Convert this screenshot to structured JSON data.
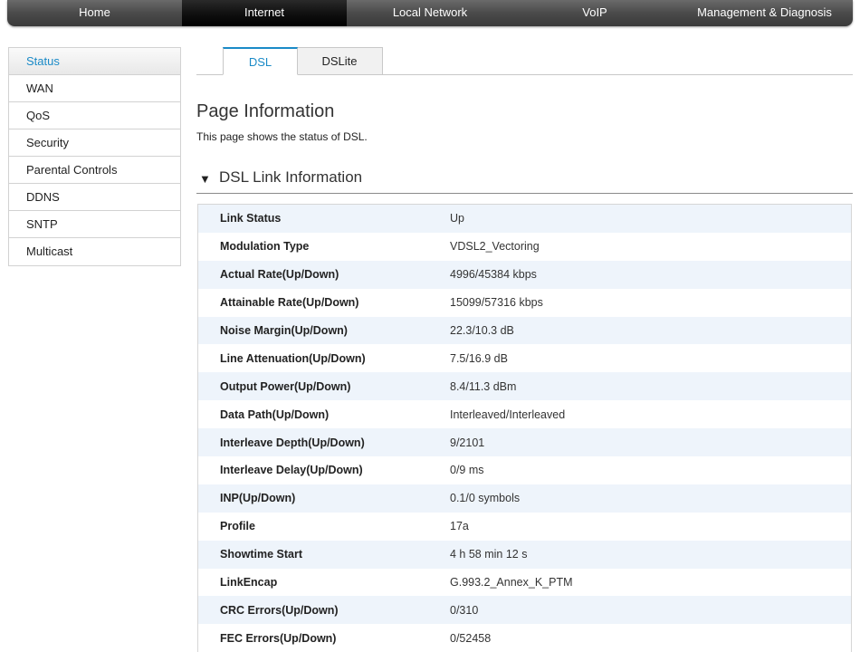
{
  "topnav": {
    "items": [
      {
        "label": "Home",
        "active": false
      },
      {
        "label": "Internet",
        "active": true
      },
      {
        "label": "Local Network",
        "active": false
      },
      {
        "label": "VoIP",
        "active": false
      },
      {
        "label": "Management & Diagnosis",
        "active": false
      }
    ]
  },
  "sidebar": {
    "items": [
      {
        "label": "Status",
        "active": true
      },
      {
        "label": "WAN"
      },
      {
        "label": "QoS"
      },
      {
        "label": "Security"
      },
      {
        "label": "Parental Controls"
      },
      {
        "label": "DDNS"
      },
      {
        "label": "SNTP"
      },
      {
        "label": "Multicast"
      }
    ]
  },
  "tabs": [
    {
      "label": "DSL",
      "active": true
    },
    {
      "label": "DSLite",
      "active": false
    }
  ],
  "page": {
    "title": "Page Information",
    "description": "This page shows the status of DSL."
  },
  "section": {
    "title": "DSL Link Information",
    "icon": "triangle-down-icon"
  },
  "dsl_info": [
    {
      "label": "Link Status",
      "value": "Up"
    },
    {
      "label": "Modulation Type",
      "value": "VDSL2_Vectoring"
    },
    {
      "label": "Actual Rate(Up/Down)",
      "value": "4996/45384 kbps"
    },
    {
      "label": "Attainable Rate(Up/Down)",
      "value": "15099/57316 kbps"
    },
    {
      "label": "Noise Margin(Up/Down)",
      "value": "22.3/10.3 dB"
    },
    {
      "label": "Line Attenuation(Up/Down)",
      "value": "7.5/16.9 dB"
    },
    {
      "label": "Output Power(Up/Down)",
      "value": "8.4/11.3 dBm"
    },
    {
      "label": "Data Path(Up/Down)",
      "value": "Interleaved/Interleaved"
    },
    {
      "label": "Interleave Depth(Up/Down)",
      "value": "9/2101"
    },
    {
      "label": "Interleave Delay(Up/Down)",
      "value": "0/9 ms"
    },
    {
      "label": "INP(Up/Down)",
      "value": "0.1/0 symbols"
    },
    {
      "label": "Profile",
      "value": "17a"
    },
    {
      "label": "Showtime Start",
      "value": "4 h 58 min 12 s"
    },
    {
      "label": "LinkEncap",
      "value": "G.993.2_Annex_K_PTM"
    },
    {
      "label": "CRC Errors(Up/Down)",
      "value": "0/310"
    },
    {
      "label": "FEC Errors(Up/Down)",
      "value": "0/52458"
    }
  ],
  "colors": {
    "accent": "#1a8ac7",
    "row_stripe": "#eef4fb",
    "nav_bg": "#4a4a4a",
    "nav_active": "#111111"
  }
}
